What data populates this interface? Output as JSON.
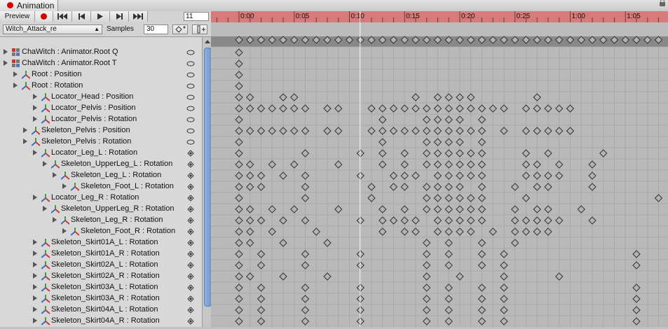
{
  "window": {
    "title": "Animation"
  },
  "toolbar": {
    "preview_label": "Preview",
    "frame_value": "11"
  },
  "clip": {
    "name": "Witch_Attack_re",
    "samples_label": "Samples",
    "samples_value": "30"
  },
  "timeline": {
    "labels": [
      "0:00",
      "0:05",
      "0:10",
      "0:15",
      "0:20",
      "0:25",
      "1:00",
      "1:05"
    ],
    "playhead_frame": 11,
    "summary_keys": [
      0,
      1,
      2,
      3,
      4,
      5,
      6,
      7,
      8,
      9,
      10,
      11,
      12,
      13,
      14,
      15,
      16,
      17,
      18,
      19,
      20,
      21,
      22,
      23,
      24,
      25,
      26,
      27,
      28,
      29,
      30,
      31,
      32,
      33,
      34,
      35,
      36,
      37,
      38
    ]
  },
  "properties": [
    {
      "label": "ChaWitch : Animator.Root Q",
      "indent": 0,
      "icon": "animator",
      "state": "eye",
      "keys": [
        0
      ]
    },
    {
      "label": "ChaWitch : Animator.Root T",
      "indent": 0,
      "icon": "animator",
      "state": "eye",
      "keys": [
        0
      ]
    },
    {
      "label": "Root : Position",
      "indent": 1,
      "icon": "transform",
      "state": "eye",
      "keys": [
        0
      ]
    },
    {
      "label": "Root : Rotation",
      "indent": 1,
      "icon": "transform",
      "state": "eye",
      "keys": [
        0
      ]
    },
    {
      "label": "Locator_Head : Position",
      "indent": 3,
      "icon": "transform",
      "state": "eye",
      "keys": [
        0,
        1,
        4,
        5,
        16,
        18,
        19,
        20,
        21,
        27
      ]
    },
    {
      "label": "Locator_Pelvis : Position",
      "indent": 3,
      "icon": "transform",
      "state": "eye",
      "keys": [
        0,
        1,
        2,
        3,
        4,
        5,
        6,
        8,
        9,
        12,
        13,
        14,
        15,
        16,
        17,
        18,
        19,
        20,
        21,
        22,
        23,
        24,
        26,
        27,
        28,
        29,
        30
      ]
    },
    {
      "label": "Locator_Pelvis : Rotation",
      "indent": 3,
      "icon": "transform",
      "state": "eye",
      "keys": [
        0,
        13,
        17,
        18,
        19,
        20,
        22
      ]
    },
    {
      "label": "Skeleton_Pelvis : Position",
      "indent": 2,
      "icon": "transform",
      "state": "eye",
      "keys": [
        0,
        1,
        2,
        3,
        4,
        5,
        6,
        8,
        9,
        12,
        13,
        14,
        15,
        16,
        17,
        18,
        19,
        20,
        21,
        22,
        24,
        26,
        27,
        28,
        29,
        30
      ]
    },
    {
      "label": "Skeleton_Pelvis : Rotation",
      "indent": 2,
      "icon": "transform",
      "state": "eye",
      "keys": [
        0,
        13,
        17,
        18,
        19,
        20,
        22
      ]
    },
    {
      "label": "Locator_Leg_L : Rotation",
      "indent": 3,
      "icon": "transform",
      "state": "key",
      "keys": [
        0,
        6,
        11,
        13,
        15,
        17,
        18,
        19,
        20,
        21,
        22,
        26,
        28,
        33
      ]
    },
    {
      "label": "Skeleton_UpperLeg_L : Rotation",
      "indent": 4,
      "icon": "transform",
      "state": "key",
      "keys": [
        0,
        1,
        3,
        5,
        9,
        13,
        15,
        17,
        18,
        19,
        20,
        21,
        22,
        26,
        27,
        29,
        32
      ]
    },
    {
      "label": "Skeleton_Leg_L : Rotation",
      "indent": 5,
      "icon": "transform",
      "state": "key",
      "keys": [
        0,
        1,
        2,
        4,
        6,
        11,
        14,
        15,
        16,
        18,
        19,
        20,
        21,
        22,
        26,
        27,
        28,
        29,
        32
      ]
    },
    {
      "label": "Skeleton_Foot_L : Rotation",
      "indent": 6,
      "icon": "transform",
      "state": "key",
      "keys": [
        0,
        1,
        2,
        6,
        12,
        14,
        15,
        17,
        18,
        19,
        20,
        22,
        25,
        27,
        28,
        32
      ]
    },
    {
      "label": "Locator_Leg_R : Rotation",
      "indent": 3,
      "icon": "transform",
      "state": "key",
      "keys": [
        0,
        6,
        12,
        17,
        18,
        19,
        20,
        21,
        22,
        26,
        38
      ]
    },
    {
      "label": "Skeleton_UpperLeg_R : Rotation",
      "indent": 4,
      "icon": "transform",
      "state": "key",
      "keys": [
        0,
        1,
        3,
        5,
        9,
        13,
        15,
        17,
        18,
        19,
        20,
        21,
        22,
        25,
        27,
        28,
        31
      ]
    },
    {
      "label": "Skeleton_Leg_R : Rotation",
      "indent": 5,
      "icon": "transform",
      "state": "key",
      "keys": [
        0,
        1,
        2,
        4,
        6,
        11,
        13,
        14,
        15,
        16,
        18,
        19,
        20,
        21,
        22,
        25,
        26,
        27,
        28,
        29,
        32
      ]
    },
    {
      "label": "Skeleton_Foot_R : Rotation",
      "indent": 6,
      "icon": "transform",
      "state": "key",
      "keys": [
        0,
        1,
        3,
        7,
        13,
        15,
        16,
        18,
        19,
        20,
        21,
        23,
        25,
        26,
        27,
        28
      ]
    },
    {
      "label": "Skeleton_Skirt01A_L : Rotation",
      "indent": 3,
      "icon": "transform",
      "state": "key",
      "keys": [
        0,
        1,
        4,
        8,
        17,
        19,
        22,
        25
      ]
    },
    {
      "label": "Skeleton_Skirt01A_R : Rotation",
      "indent": 3,
      "icon": "transform",
      "state": "key",
      "keys": [
        0,
        2,
        6,
        11,
        17,
        19,
        22,
        24,
        36
      ]
    },
    {
      "label": "Skeleton_Skirt02A_L : Rotation",
      "indent": 3,
      "icon": "transform",
      "state": "key",
      "keys": [
        0,
        2,
        6,
        11,
        17,
        19,
        22,
        24,
        36
      ]
    },
    {
      "label": "Skeleton_Skirt02A_R : Rotation",
      "indent": 3,
      "icon": "transform",
      "state": "key",
      "keys": [
        0,
        1,
        4,
        8,
        17,
        20,
        24,
        29
      ]
    },
    {
      "label": "Skeleton_Skirt03A_L : Rotation",
      "indent": 3,
      "icon": "transform",
      "state": "key",
      "keys": [
        0,
        2,
        6,
        11,
        17,
        19,
        22,
        24,
        36
      ]
    },
    {
      "label": "Skeleton_Skirt03A_R : Rotation",
      "indent": 3,
      "icon": "transform",
      "state": "key",
      "keys": [
        0,
        2,
        6,
        11,
        17,
        19,
        22,
        24,
        36
      ]
    },
    {
      "label": "Skeleton_Skirt04A_L : Rotation",
      "indent": 3,
      "icon": "transform",
      "state": "key",
      "keys": [
        0,
        2,
        6,
        11,
        17,
        19,
        22,
        24,
        36
      ]
    },
    {
      "label": "Skeleton_Skirt04A_R : Rotation",
      "indent": 3,
      "icon": "transform",
      "state": "key",
      "keys": [
        0,
        2,
        6,
        11,
        17,
        19,
        22,
        24,
        36
      ]
    }
  ]
}
